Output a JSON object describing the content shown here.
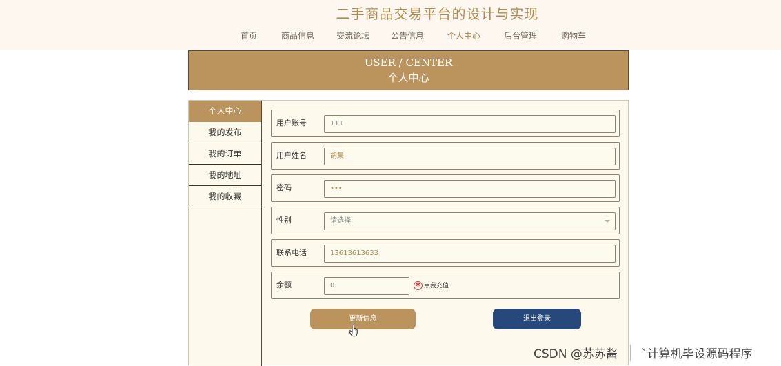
{
  "site": {
    "title": "二手商品交易平台的设计与实现"
  },
  "nav": {
    "items": [
      {
        "label": "首页"
      },
      {
        "label": "商品信息"
      },
      {
        "label": "交流论坛"
      },
      {
        "label": "公告信息"
      },
      {
        "label": "个人中心"
      },
      {
        "label": "后台管理"
      },
      {
        "label": "购物车"
      }
    ],
    "active": "个人中心"
  },
  "banner": {
    "title_en": "USER / CENTER",
    "title_cn": "个人中心"
  },
  "sidebar": {
    "items": [
      {
        "label": "个人中心"
      },
      {
        "label": "我的发布"
      },
      {
        "label": "我的订单"
      },
      {
        "label": "我的地址"
      },
      {
        "label": "我的收藏"
      }
    ],
    "active": "个人中心"
  },
  "form": {
    "account": {
      "label": "用户账号",
      "value": "111"
    },
    "name": {
      "label": "用户姓名",
      "value": "胡集"
    },
    "password": {
      "label": "密码",
      "value": "•••"
    },
    "gender": {
      "label": "性别",
      "placeholder": "请选择"
    },
    "phone": {
      "label": "联系电话",
      "value": "13613613633"
    },
    "balance": {
      "label": "余额",
      "value": "0",
      "recharge_label": "点我充值"
    }
  },
  "buttons": {
    "update": "更新信息",
    "logout": "退出登录"
  },
  "watermark": {
    "left": "CSDN @苏苏酱",
    "right": "`计算机毕设源码程序"
  },
  "colors": {
    "accent": "#bb945d",
    "logout": "#27487a",
    "panel": "#fdf9ec"
  }
}
